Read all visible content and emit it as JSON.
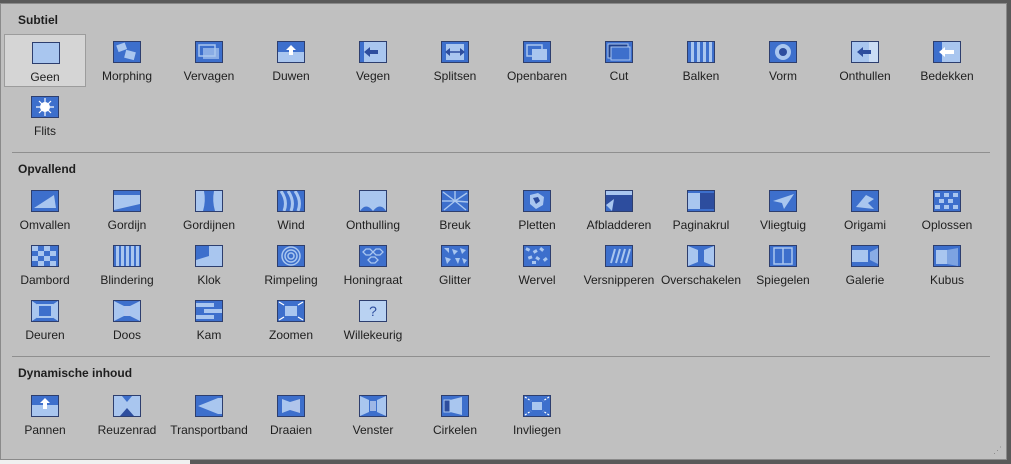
{
  "sections": [
    {
      "title": "Subtiel",
      "items": [
        {
          "label": "Geen",
          "icon": "none-icon",
          "selected": true
        },
        {
          "label": "Morphing",
          "icon": "morph-icon"
        },
        {
          "label": "Vervagen",
          "icon": "fade-icon"
        },
        {
          "label": "Duwen",
          "icon": "push-icon"
        },
        {
          "label": "Vegen",
          "icon": "wipe-icon"
        },
        {
          "label": "Splitsen",
          "icon": "split-icon"
        },
        {
          "label": "Openbaren",
          "icon": "reveal-icon"
        },
        {
          "label": "Cut",
          "icon": "cut-icon"
        },
        {
          "label": "Balken",
          "icon": "bars-icon"
        },
        {
          "label": "Vorm",
          "icon": "shape-icon"
        },
        {
          "label": "Onthullen",
          "icon": "uncover-icon"
        },
        {
          "label": "Bedekken",
          "icon": "cover-icon"
        },
        {
          "label": "Flits",
          "icon": "flash-icon"
        }
      ]
    },
    {
      "title": "Opvallend",
      "items": [
        {
          "label": "Omvallen",
          "icon": "fall-over-icon"
        },
        {
          "label": "Gordijn",
          "icon": "drape-icon"
        },
        {
          "label": "Gordijnen",
          "icon": "curtains-icon"
        },
        {
          "label": "Wind",
          "icon": "wind-icon"
        },
        {
          "label": "Onthulling",
          "icon": "prestige-icon"
        },
        {
          "label": "Breuk",
          "icon": "fracture-icon"
        },
        {
          "label": "Pletten",
          "icon": "crush-icon"
        },
        {
          "label": "Afbladderen",
          "icon": "peel-off-icon"
        },
        {
          "label": "Paginakrul",
          "icon": "page-curl-icon"
        },
        {
          "label": "Vliegtuig",
          "icon": "airplane-icon"
        },
        {
          "label": "Origami",
          "icon": "origami-icon"
        },
        {
          "label": "Oplossen",
          "icon": "dissolve-icon"
        },
        {
          "label": "Dambord",
          "icon": "checkerboard-icon"
        },
        {
          "label": "Blindering",
          "icon": "blinds-icon"
        },
        {
          "label": "Klok",
          "icon": "clock-icon"
        },
        {
          "label": "Rimpeling",
          "icon": "ripple-icon"
        },
        {
          "label": "Honingraat",
          "icon": "honeycomb-icon"
        },
        {
          "label": "Glitter",
          "icon": "glitter-icon"
        },
        {
          "label": "Wervel",
          "icon": "vortex-icon"
        },
        {
          "label": "Versnipperen",
          "icon": "shred-icon"
        },
        {
          "label": "Overschakelen",
          "icon": "switch-icon"
        },
        {
          "label": "Spiegelen",
          "icon": "flip-icon"
        },
        {
          "label": "Galerie",
          "icon": "gallery-icon"
        },
        {
          "label": "Kubus",
          "icon": "cube-icon"
        },
        {
          "label": "Deuren",
          "icon": "doors-icon"
        },
        {
          "label": "Doos",
          "icon": "box-icon"
        },
        {
          "label": "Kam",
          "icon": "comb-icon"
        },
        {
          "label": "Zoomen",
          "icon": "zoom-icon"
        },
        {
          "label": "Willekeurig",
          "icon": "random-icon"
        }
      ]
    },
    {
      "title": "Dynamische inhoud",
      "items": [
        {
          "label": "Pannen",
          "icon": "pan-icon"
        },
        {
          "label": "Reuzenrad",
          "icon": "ferris-wheel-icon"
        },
        {
          "label": "Transportband",
          "icon": "conveyor-icon"
        },
        {
          "label": "Draaien",
          "icon": "rotate-icon"
        },
        {
          "label": "Venster",
          "icon": "window-icon"
        },
        {
          "label": "Cirkelen",
          "icon": "orbit-icon"
        },
        {
          "label": "Invliegen",
          "icon": "fly-through-icon"
        }
      ]
    }
  ],
  "colors": {
    "thumb_fill": "#3d6fcc",
    "thumb_light": "#a9c6ef",
    "thumb_border": "#2d3e6e"
  }
}
